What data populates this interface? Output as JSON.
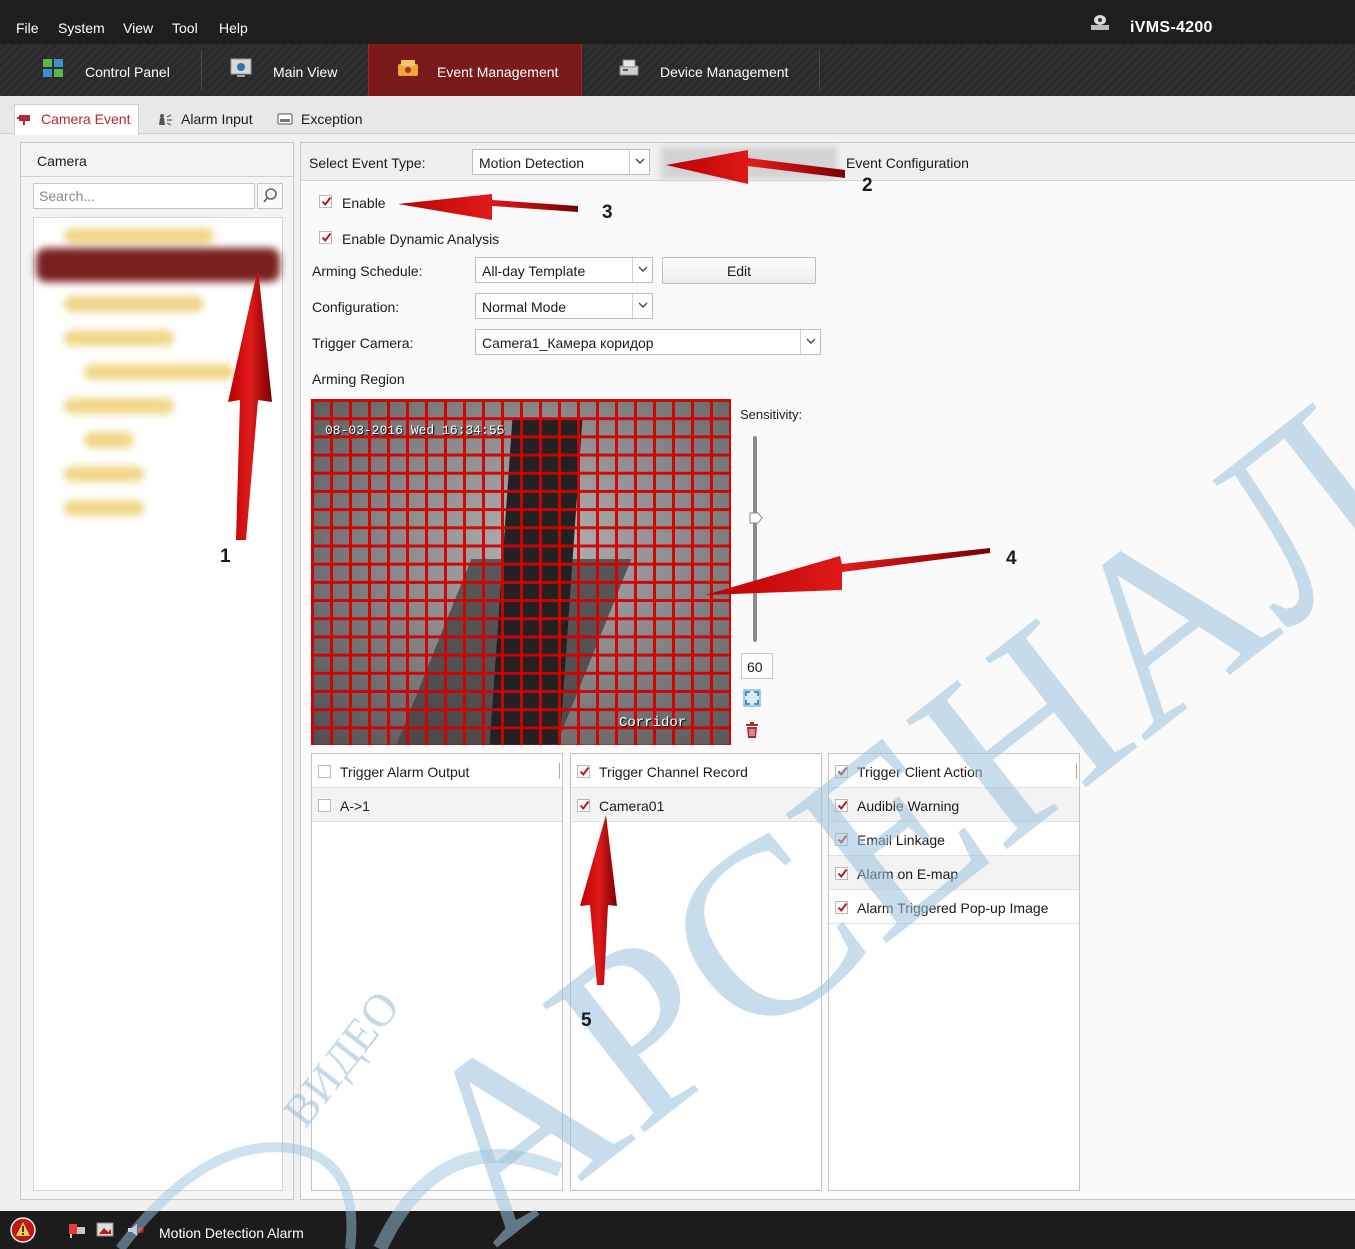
{
  "menu": {
    "items": [
      "File",
      "System",
      "View",
      "Tool",
      "Help"
    ]
  },
  "app_title": "iVMS-4200",
  "modules": {
    "control_panel": "Control Panel",
    "main_view": "Main View",
    "event_management": "Event Management",
    "device_management": "Device Management"
  },
  "subtabs": {
    "camera_event": "Camera Event",
    "alarm_input": "Alarm Input",
    "exception": "Exception"
  },
  "camera_panel": {
    "title": "Camera",
    "search_placeholder": "Search..."
  },
  "event": {
    "select_type_label": "Select Event Type:",
    "select_type_value": "Motion Detection",
    "event_config_label": "Event Configuration",
    "enable_label": "Enable",
    "enable_checked": true,
    "dynamic_label": "Enable Dynamic Analysis",
    "dynamic_checked": true,
    "arming_schedule_label": "Arming Schedule:",
    "arming_schedule_value": "All-day Template",
    "edit_label": "Edit",
    "configuration_label": "Configuration:",
    "configuration_value": "Normal Mode",
    "trigger_camera_label": "Trigger Camera:",
    "trigger_camera_value": "Camera1_Камера коридор",
    "arming_region_label": "Arming Region",
    "sensitivity_label": "Sensitivity:",
    "sensitivity_value": "60",
    "osd_time": "08-03-2016 Wed 16:34:55",
    "osd_name": "Corridor"
  },
  "linkage": {
    "alarm_output": {
      "header": "Trigger Alarm Output",
      "checked": false,
      "items": [
        {
          "label": "A->1",
          "checked": false
        }
      ]
    },
    "channel_record": {
      "header": "Trigger Channel Record",
      "checked": true,
      "items": [
        {
          "label": "Camera01",
          "checked": true
        }
      ]
    },
    "client_action": {
      "header": "Trigger Client Action",
      "checked": true,
      "items": [
        {
          "label": "Audible Warning",
          "checked": true
        },
        {
          "label": "Email Linkage",
          "checked": true
        },
        {
          "label": "Alarm on E-map",
          "checked": true
        },
        {
          "label": "Alarm Triggered Pop-up Image",
          "checked": true
        }
      ]
    }
  },
  "status": {
    "text": "Motion Detection Alarm"
  },
  "annotations": [
    "1",
    "2",
    "3",
    "4",
    "5"
  ],
  "watermark": {
    "main": "АРСЕНАЛ",
    "small": "ВИДЕО"
  },
  "colors": {
    "accent_red": "#b5282d",
    "annotation_red": "#c41212",
    "watermark_blue": "#9cc3dd"
  }
}
